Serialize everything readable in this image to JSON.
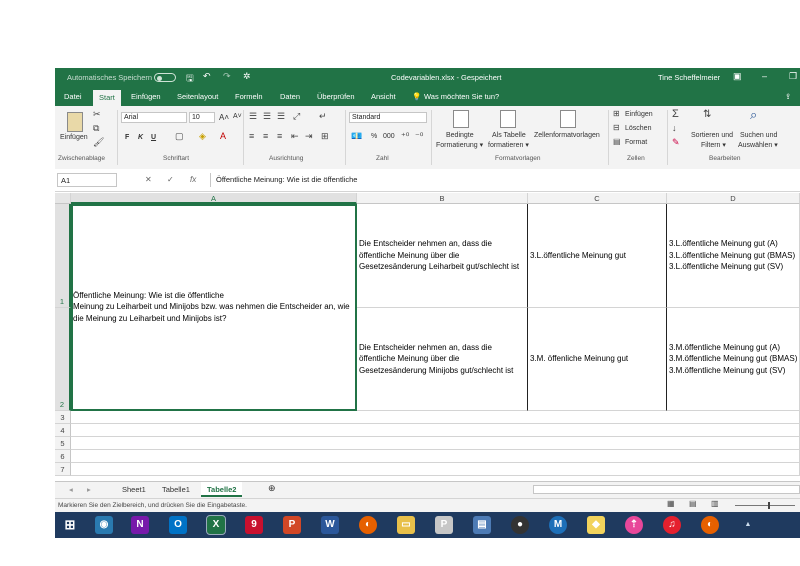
{
  "titlebar": {
    "autosave": "Automatisches Speichern",
    "filename": "Codevariablen.xlsx  -  Gespeichert",
    "user": "Tine Scheffelmeier"
  },
  "tabs": [
    "Datei",
    "Start",
    "Einfügen",
    "Seitenlayout",
    "Formeln",
    "Daten",
    "Überprüfen",
    "Ansicht"
  ],
  "active_tab": "Start",
  "tell_me": "Was möchten Sie tun?",
  "ribbon": {
    "paste": "Einfügen",
    "font_name": "Arial",
    "font_size": "10",
    "bold": "F",
    "italic": "K",
    "underline": "U",
    "number_format": "Standard",
    "percent": "%",
    "thousands": "000",
    "cond_format": "Bedingte",
    "cond_format2": "Formatierung ▾",
    "as_table": "Als Tabelle",
    "as_table2": "formatieren ▾",
    "cell_styles": "Zellenformatvorlagen",
    "insert": "Einfügen",
    "delete": "Löschen",
    "format": "Format",
    "sort": "Sortieren und",
    "sort2": "Filtern ▾",
    "find": "Suchen und",
    "find2": "Auswählen ▾",
    "groups": [
      "Zwischenablage",
      "Schriftart",
      "Ausrichtung",
      "Zahl",
      "Formatvorlagen",
      "Zellen",
      "Bearbeiten"
    ]
  },
  "formula_bar": {
    "namebox": "A1",
    "fx": "fx",
    "content": "Öffentliche Meinung: Wie ist die öffentliche"
  },
  "columns": [
    "A",
    "B",
    "C",
    "D"
  ],
  "rows": [
    "1",
    "2",
    "3",
    "4",
    "5",
    "6",
    "7"
  ],
  "cells": {
    "A1": "Öffentliche Meinung: Wie ist die öffentliche\nMeinung zu Leiharbeit und Minijobs bzw. was nehmen die Entscheider an, wie die Meinung zu Leiharbeit und Minijobs ist?",
    "B1": "Die Entscheider nehmen an, dass die öffentliche Meinung über die Gesetzesänderung Leiharbeit gut/schlecht ist",
    "C1": "3.L.öffentliche Meinung gut",
    "D1": "3.L.öffentliche Meinung gut (A)\n3.L.öffentliche Meinung gut (BMAS)\n3.L.öffentliche Meinung gut (SV)",
    "B2": "Die Entscheider nehmen an, dass die öffentliche Meinung über die Gesetzesänderung Minijobs gut/schlecht ist",
    "C2": "3.M. öffenliche Meinung gut",
    "D2": "3.M.öffentliche Meinung gut (A)\n3.M.öffentliche Meinung gut (BMAS)\n3.M.öffentliche Meinung gut (SV)"
  },
  "sheets": [
    "Sheet1",
    "Tabelle1",
    "Tabelle2"
  ],
  "active_sheet": "Tabelle2",
  "status_text": "Markieren Sie den Zielbereich, und drücken Sie die Eingabetaste.",
  "colors": {
    "excel_green": "#217346",
    "taskbar": "#1f3a5f"
  }
}
